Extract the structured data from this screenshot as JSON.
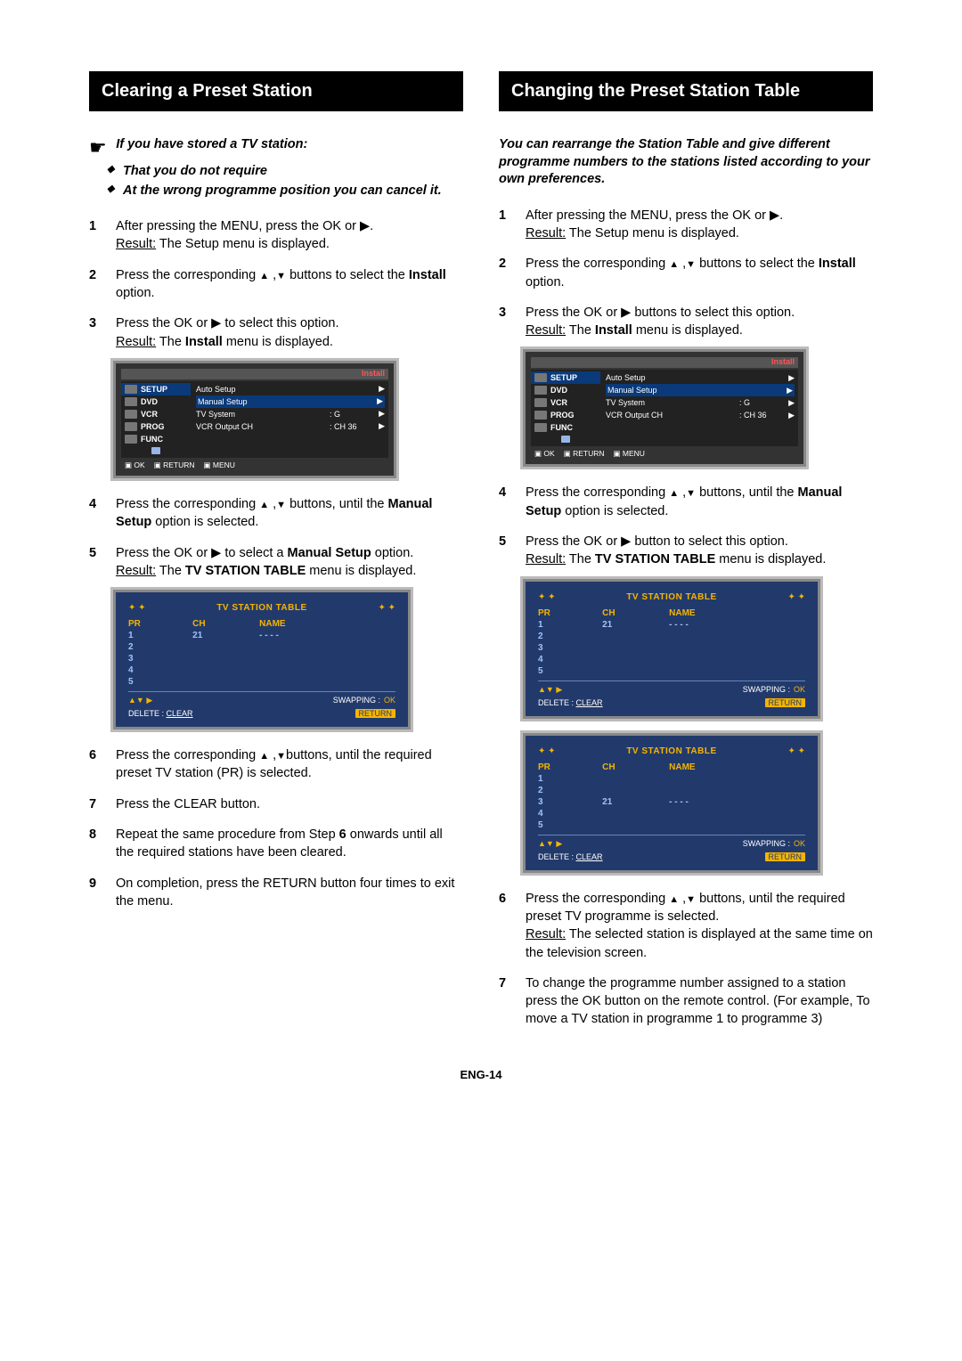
{
  "page_number": "ENG-14",
  "left": {
    "title": "Clearing a Preset Station",
    "intro_lead": "If you have stored a TV station:",
    "intro_bullets": [
      "That you do not require",
      "At the wrong programme position you can cancel it."
    ],
    "steps": [
      {
        "n": "1",
        "html": "After pressing the MENU, press the OK or ▶.<br><u>Result:</u> The Setup menu is displayed."
      },
      {
        "n": "2",
        "html": "Press the corresponding <span class='tri'>▲</span> ,<span class='tri'>▼</span> buttons to select the <b>Install</b> option."
      },
      {
        "n": "3",
        "html": "Press the OK or ▶ to select this option.<br><u>Result:</u> The <b>Install</b> menu is displayed."
      },
      {
        "n": "4",
        "html": "Press the corresponding <span class='tri'>▲</span> ,<span class='tri'>▼</span> buttons, until the <b>Manual Setup</b> option is selected."
      },
      {
        "n": "5",
        "html": "Press the OK or ▶ to select a <b>Manual Setup</b> option.<br><u>Result:</u> The <b>TV STATION TABLE</b> menu is displayed."
      },
      {
        "n": "6",
        "html": "Press the corresponding <span class='tri'>▲</span> ,<span class='tri'>▼</span>buttons, until the required preset TV station (PR) is selected."
      },
      {
        "n": "7",
        "html": "Press the CLEAR button."
      },
      {
        "n": "8",
        "html": "Repeat the same procedure from Step <b>6</b> onwards until all the required stations have been cleared."
      },
      {
        "n": "9",
        "html": "On completion, press the RETURN button four times to exit the menu."
      }
    ]
  },
  "right": {
    "title": "Changing the Preset Station Table",
    "intro": "You can rearrange the Station Table and give different programme numbers to the stations listed according to your own preferences.",
    "steps_a": [
      {
        "n": "1",
        "html": "After pressing the MENU, press the OK or ▶.<br><u>Result:</u> The Setup menu is displayed."
      },
      {
        "n": "2",
        "html": "Press the corresponding <span class='tri'>▲</span> ,<span class='tri'>▼</span> buttons to select the <b>Install</b> option."
      },
      {
        "n": "3",
        "html": "Press the OK or ▶ buttons to select this option.<br><u>Result:</u> The <b>Install</b> menu is displayed."
      }
    ],
    "steps_b": [
      {
        "n": "4",
        "html": "Press the corresponding <span class='tri'>▲</span> ,<span class='tri'>▼</span> buttons, until the <b>Manual Setup</b> option is selected."
      },
      {
        "n": "5",
        "html": "Press the OK or ▶ button to select this option.<br><u>Result:</u> The <b>TV STATION TABLE</b> menu is displayed."
      }
    ],
    "steps_c": [
      {
        "n": "6",
        "html": "Press the corresponding <span class='tri'>▲</span> ,<span class='tri'>▼</span> buttons, until the required preset TV programme is selected.<br><u>Result:</u> The selected station is displayed at the same time on the television screen."
      },
      {
        "n": "7",
        "html": "To change the programme number assigned to a station press the OK button on the remote control. (For example, To move a TV station in programme 1 to programme 3)"
      }
    ]
  },
  "osd_install": {
    "corner": "Install",
    "tabs": [
      "SETUP",
      "DVD",
      "VCR",
      "PROG",
      "FUNC"
    ],
    "rows": [
      {
        "name": "Auto Setup",
        "val": "",
        "arrow": "▶"
      },
      {
        "name": "Manual Setup",
        "val": "",
        "arrow": "▶",
        "sel": true
      },
      {
        "name": "TV System",
        "val": ": G",
        "arrow": "▶"
      },
      {
        "name": "VCR Output CH",
        "val": ": CH 36",
        "arrow": "▶"
      }
    ],
    "foot": [
      "OK",
      "RETURN",
      "MENU"
    ]
  },
  "tst_common": {
    "title": "TV STATION TABLE",
    "stars": "✦ ✦",
    "cols": [
      "PR",
      "CH",
      "NAME"
    ],
    "footer_delete_label": "DELETE :",
    "footer_delete_value": "CLEAR",
    "footer_swapping_label": "SWAPPING :",
    "footer_swapping_value": "OK",
    "footer_return": "RETURN"
  },
  "tst_left": {
    "rows": [
      [
        "1",
        "21",
        "- - - -"
      ],
      [
        "2",
        "",
        ""
      ],
      [
        "3",
        "",
        ""
      ],
      [
        "4",
        "",
        ""
      ],
      [
        "5",
        "",
        ""
      ]
    ]
  },
  "tst_right1": {
    "rows": [
      [
        "1",
        "21",
        "- - - -"
      ],
      [
        "2",
        "",
        ""
      ],
      [
        "3",
        "",
        ""
      ],
      [
        "4",
        "",
        ""
      ],
      [
        "5",
        "",
        ""
      ]
    ]
  },
  "tst_right2": {
    "rows": [
      [
        "1",
        "",
        ""
      ],
      [
        "2",
        "",
        ""
      ],
      [
        "3",
        "21",
        "- - - -"
      ],
      [
        "4",
        "",
        ""
      ],
      [
        "5",
        "",
        ""
      ]
    ]
  }
}
